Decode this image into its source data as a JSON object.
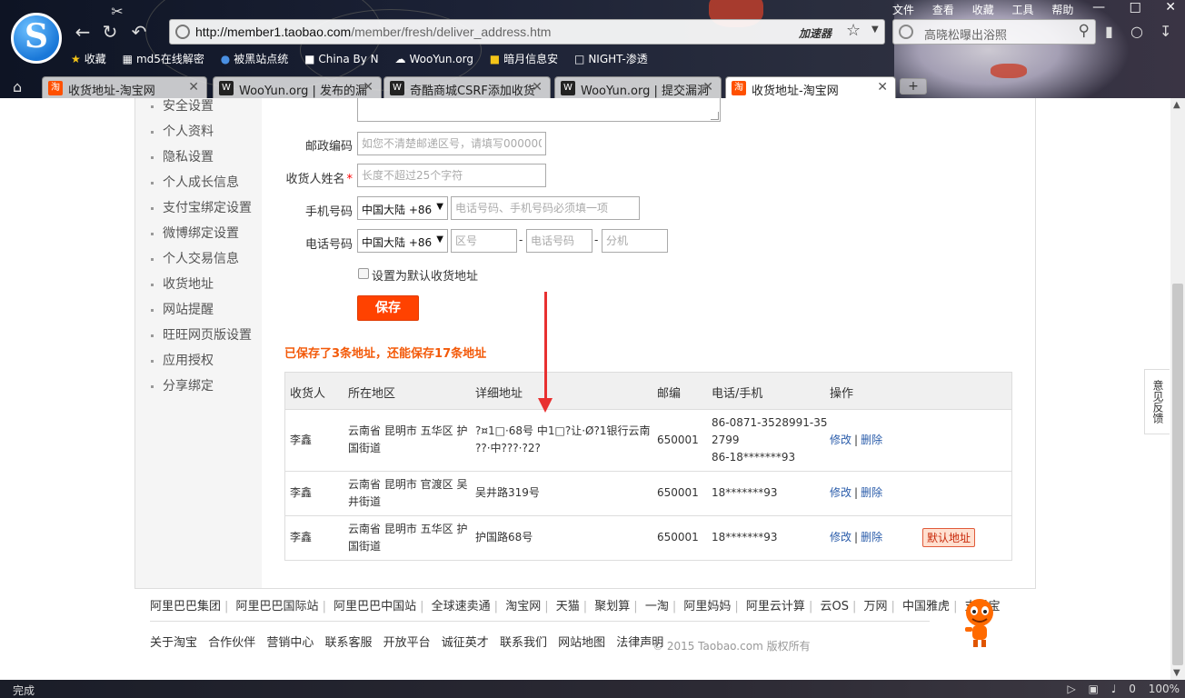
{
  "browser": {
    "url_host": "http://member1.taobao.com",
    "url_path": "/member/fresh/deliver_address.htm",
    "accelerator": "加速器",
    "search_text": "高晓松曝出浴照",
    "menu": [
      "文件",
      "查看",
      "收藏",
      "工具",
      "帮助"
    ],
    "bookmarks": [
      "收藏",
      "md5在线解密",
      "被黑站点统",
      "China By N",
      "WooYun.org",
      "暗月信息安",
      "NIGHT-渗透"
    ],
    "tabs": [
      {
        "label": "收货地址-淘宝网",
        "favicon": "taobao"
      },
      {
        "label": "WooYun.org | 发布的漏",
        "favicon": "wooyun"
      },
      {
        "label": "奇酷商城CSRF添加收货",
        "favicon": "wooyun"
      },
      {
        "label": "WooYun.org | 提交漏洞",
        "favicon": "wooyun"
      },
      {
        "label": "收货地址-淘宝网",
        "favicon": "taobao"
      }
    ],
    "add_tab": "+",
    "status": "完成",
    "zoom": "100%",
    "counter": "0"
  },
  "sidenav": [
    "安全设置",
    "个人资料",
    "隐私设置",
    "个人成长信息",
    "支付宝绑定设置",
    "微博绑定设置",
    "个人交易信息",
    "收货地址",
    "网站提醒",
    "旺旺网页版设置",
    "应用授权",
    "分享绑定"
  ],
  "form": {
    "zip_label": "邮政编码",
    "zip_placeholder": "如您不清楚邮递区号，请填写000000",
    "name_label": "收货人姓名",
    "name_required": "*",
    "name_placeholder": "长度不超过25个字符",
    "mobile_label": "手机号码",
    "mobile_country": "中国大陆 +86",
    "mobile_placeholder": "电话号码、手机号码必须填一项",
    "phone_label": "电话号码",
    "phone_country": "中国大陆 +86",
    "area_placeholder": "区号",
    "phone_placeholder": "电话号码",
    "ext_placeholder": "分机",
    "default_label": "设置为默认收货地址",
    "save_label": "保存"
  },
  "saved_note": "已保存了3条地址，还能保存17条地址",
  "table": {
    "headers": [
      "收货人",
      "所在地区",
      "详细地址",
      "邮编",
      "电话/手机",
      "操作"
    ],
    "rows": [
      {
        "name": "李鑫",
        "region_1": "云南省 昆明市 五华区 护",
        "region_2": "国街道",
        "address_1": "?¤1□·68号 中1□?让·Ø?1银行云南",
        "address_2": "??·中???·?2?",
        "zip": "650001",
        "phone_1": "86-0871-3528991-35",
        "phone_2": "2799",
        "phone_3": "86-18*******93",
        "edit": "修改",
        "delete": "删除"
      },
      {
        "name": "李鑫",
        "region_1": "云南省 昆明市 官渡区 吴",
        "region_2": "井街道",
        "address": "吴井路319号",
        "zip": "650001",
        "phone": "18*******93",
        "edit": "修改",
        "delete": "删除"
      },
      {
        "name": "李鑫",
        "region_1": "云南省 昆明市 五华区 护",
        "region_2": "国街道",
        "address": "护国路68号",
        "zip": "650001",
        "phone": "18*******93",
        "edit": "修改",
        "delete": "删除",
        "default_tag": "默认地址"
      }
    ]
  },
  "feedback": "意见反馈",
  "footer": {
    "links1": [
      "阿里巴巴集团",
      "阿里巴巴国际站",
      "阿里巴巴中国站",
      "全球速卖通",
      "淘宝网",
      "天猫",
      "聚划算",
      "一淘",
      "阿里妈妈",
      "阿里云计算",
      "云OS",
      "万网",
      "中国雅虎",
      "支付宝"
    ],
    "links2": [
      "关于淘宝",
      "合作伙伴",
      "营销中心",
      "联系客服",
      "开放平台",
      "诚征英才",
      "联系我们",
      "网站地图",
      "法律声明"
    ],
    "copyright": "© 2015 Taobao.com 版权所有"
  },
  "colors": {
    "accent": "#ff4200",
    "note": "#f35a0a",
    "link": "#2a5caa",
    "arrow": "#e83030"
  }
}
